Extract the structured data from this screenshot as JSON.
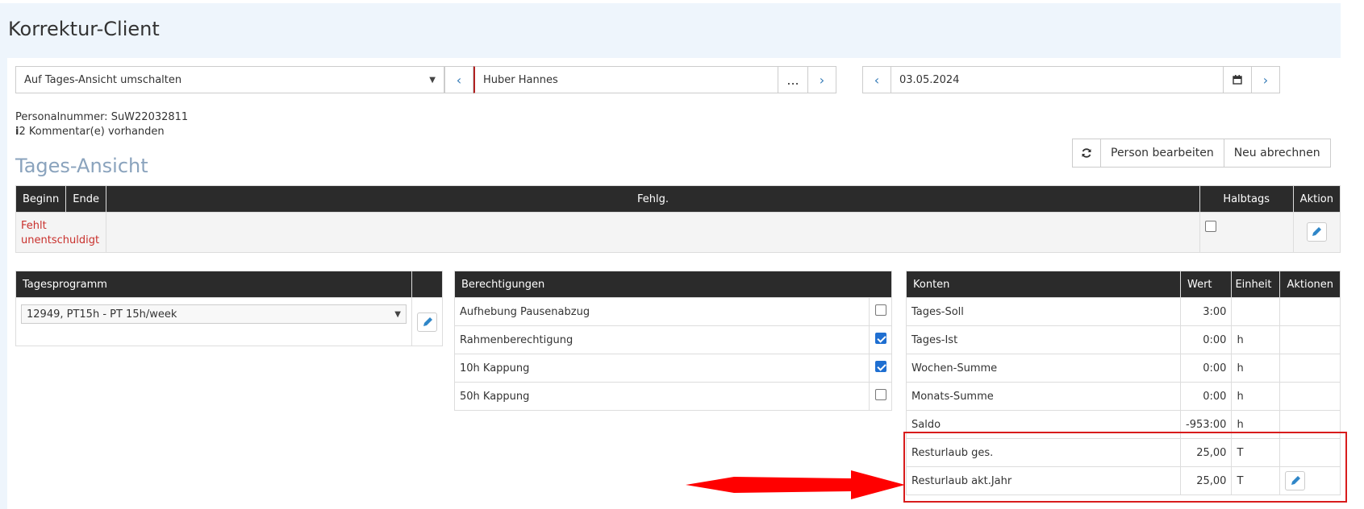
{
  "app": {
    "title": "Korrektur-Client"
  },
  "view_select": {
    "value": "Auf Tages-Ansicht umschalten"
  },
  "person": {
    "name": "Huber Hannes",
    "more_label": "..."
  },
  "date": {
    "value": "03.05.2024"
  },
  "info": {
    "personalnummer": "Personalnummer: SuW22032811",
    "kommentar_count": "2",
    "kommentar_text": " Kommentar(e) vorhanden"
  },
  "section": {
    "title": "Tages-Ansicht"
  },
  "actions": {
    "edit_person": "Person bearbeiten",
    "recalc": "Neu abrechnen"
  },
  "day_table": {
    "headers": {
      "beginn": "Beginn",
      "ende": "Ende",
      "fehlg": "Fehlg.",
      "halbtags": "Halbtags",
      "aktion": "Aktion"
    },
    "row": {
      "status_line1": "Fehlt",
      "status_line2": "unentschuldigt"
    }
  },
  "tagesprogramm": {
    "header": "Tagesprogramm",
    "value": "12949, PT15h - PT 15h/week"
  },
  "berechtigungen": {
    "header": "Berechtigungen",
    "items": [
      {
        "label": "Aufhebung Pausenabzug",
        "checked": false
      },
      {
        "label": "Rahmenberechtigung",
        "checked": true
      },
      {
        "label": "10h Kappung",
        "checked": true
      },
      {
        "label": "50h Kappung",
        "checked": false
      }
    ]
  },
  "konten": {
    "headers": {
      "konten": "Konten",
      "wert": "Wert",
      "einheit": "Einheit",
      "aktionen": "Aktionen"
    },
    "rows": [
      {
        "name": "Tages-Soll",
        "wert": "3:00",
        "einheit": ""
      },
      {
        "name": "Tages-Ist",
        "wert": "0:00",
        "einheit": "h"
      },
      {
        "name": "Wochen-Summe",
        "wert": "0:00",
        "einheit": "h"
      },
      {
        "name": "Monats-Summe",
        "wert": "0:00",
        "einheit": "h"
      },
      {
        "name": "Saldo",
        "wert": "-953:00",
        "einheit": "h"
      },
      {
        "name": "Resturlaub ges.",
        "wert": "25,00",
        "einheit": "T"
      },
      {
        "name": "Resturlaub akt.Jahr",
        "wert": "25,00",
        "einheit": "T"
      }
    ]
  },
  "colors": {
    "accent": "#337ab7",
    "header_bg": "#2b2b2b",
    "highlight": "#d81c1c",
    "error_text": "#c9302c"
  }
}
